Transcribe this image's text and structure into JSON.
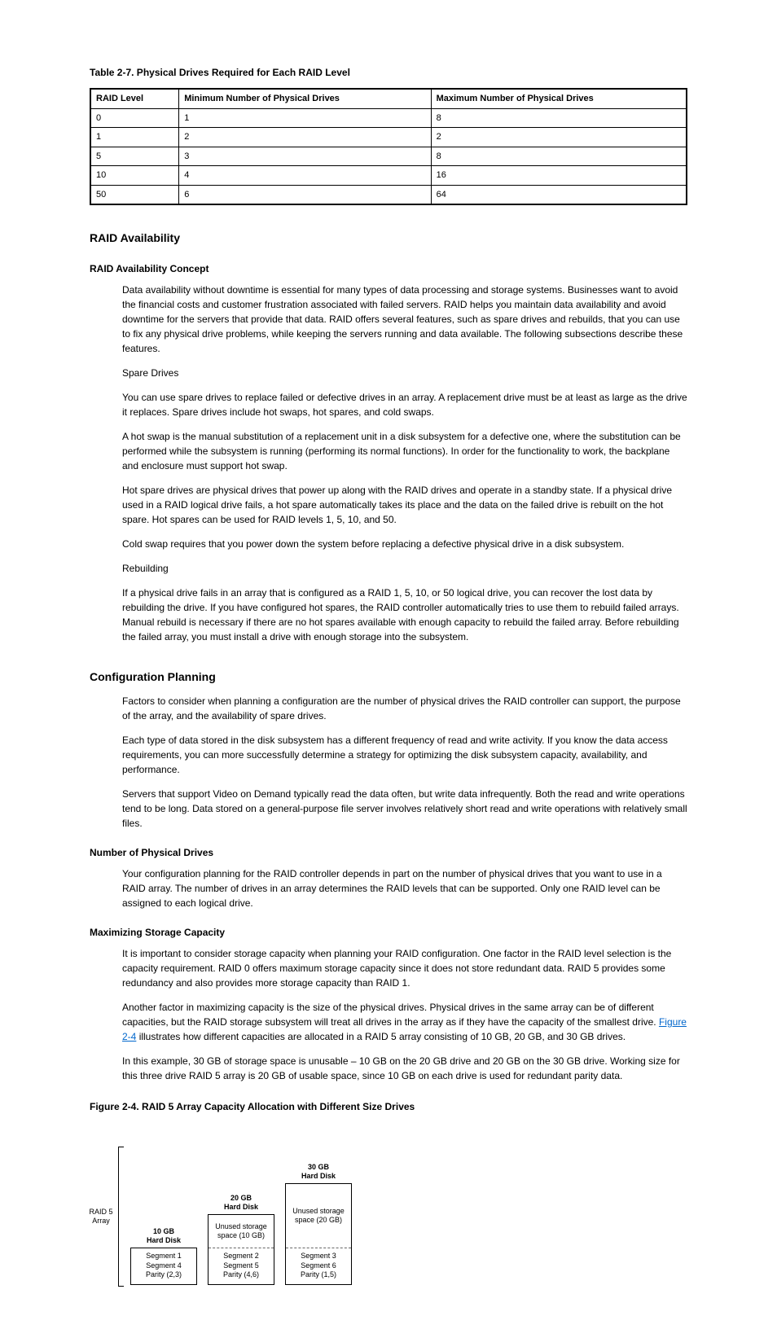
{
  "table7": {
    "title_prefix": "Table 2-",
    "title": "7. Physical Drives Required for Each RAID Level",
    "headers": [
      "RAID Level",
      "Minimum Number of Physical Drives",
      "Maximum Number of Physical Drives"
    ],
    "rows": [
      [
        "0",
        "1",
        "8"
      ],
      [
        "1",
        "2",
        "2"
      ],
      [
        "5",
        "3",
        "8"
      ],
      [
        "10",
        "4",
        "16"
      ],
      [
        "50",
        "6",
        "64"
      ]
    ]
  },
  "raid_avail": {
    "heading": "RAID Availability",
    "subheading": "RAID Availability Concept",
    "paragraphs": [
      "Data availability without downtime is essential for many types of data processing and storage systems. Businesses want to avoid the financial costs and customer frustration associated with failed servers. RAID helps you maintain data availability and avoid downtime for the servers that provide that data. RAID offers several features, such as spare drives and rebuilds, that you can use to fix any physical drive problems, while keeping the servers running and data available. The following subsections describe these features.",
      "Spare Drives",
      "You can use spare drives to replace failed or defective drives in an array. A replacement drive must be at least as large as the drive it replaces. Spare drives include hot swaps, hot spares, and cold swaps.",
      "A hot swap is the manual substitution of a replacement unit in a disk subsystem for a defective one, where the substitution can be performed while the subsystem is running (performing its normal functions). In order for the functionality to work, the backplane and enclosure must support hot swap.",
      "Hot spare drives are physical drives that power up along with the RAID drives and operate in a standby state. If a physical drive used in a RAID logical drive fails, a hot spare automatically takes its place and the data on the failed drive is rebuilt on the hot spare. Hot spares can be used for RAID levels 1, 5, 10, and 50.",
      "Cold swap requires that you power down the system before replacing a defective physical drive in a disk subsystem.",
      "Rebuilding",
      "If a physical drive fails in an array that is configured as a RAID 1, 5, 10, or 50 logical drive, you can recover the lost data by rebuilding the drive. If you have configured hot spares, the RAID controller automatically tries to use them to rebuild failed arrays. Manual rebuild is necessary if there are no hot spares available with enough capacity to rebuild the failed array. Before rebuilding the failed array, you must install a drive with enough storage into the subsystem."
    ]
  },
  "config": {
    "heading": "Configuration Planning",
    "paragraphs": [
      "Factors to consider when planning a configuration are the number of physical drives the RAID controller can support, the purpose of the array, and the availability of spare drives.",
      "Each type of data stored in the disk subsystem has a different frequency of read and write activity. If you know the data access requirements, you can more successfully determine a strategy for optimizing the disk subsystem capacity, availability, and performance.",
      "Servers that support Video on Demand typically read the data often, but write data infrequently. Both the read and write operations tend to be long. Data stored on a general-purpose file server involves relatively short read and write operations with relatively small files."
    ],
    "sub1_heading": "Number of Physical Drives",
    "sub1_paragraphs": [
      "Your configuration planning for the RAID controller depends in part on the number of physical drives that you want to use in a RAID array. The number of drives in an array determines the RAID levels that can be supported. Only one RAID level can be assigned to each logical drive."
    ],
    "sub2_heading": "Maximizing Storage Capacity",
    "sub2_paragraphs": [
      "It is important to consider storage capacity when planning your RAID configuration. One factor in the RAID level selection is the capacity requirement. RAID 0 offers maximum storage capacity since it does not store redundant data. RAID 5 provides some redundancy and also provides more storage capacity than RAID 1."
    ],
    "figlink_pre": "Another factor in maximizing capacity is the size of the physical drives. Physical drives in the same array can be of different capacities, but the RAID storage subsystem will treat all drives in the array as if they have the capacity of the smallest drive. ",
    "figlink_label": "Figure 2-4",
    "figlink_post": " illustrates how different capacities are allocated in a RAID 5 array consisting of 10 GB, 20 GB, and 30 GB drives.",
    "sub2_paragraphs2": [
      "In this example, 30 GB of storage space is unusable – 10 GB on the 20 GB drive and 20 GB on the 30 GB drive. Working size for this three drive RAID 5 array is 20 GB of usable space, since 10 GB on each drive is used for redundant parity data."
    ]
  },
  "figure": {
    "caption": "Figure 2-4.  RAID 5 Array Capacity Allocation with Different Size Drives",
    "array_label_l1": "RAID 5",
    "array_label_l2": "Array",
    "cols": [
      {
        "cap_l1": "10 GB",
        "cap_l2": "Hard Disk",
        "unused": "",
        "seg": [
          "Segment 1",
          "Segment 4",
          "Parity (2,3)"
        ]
      },
      {
        "cap_l1": "20 GB",
        "cap_l2": "Hard Disk",
        "unused": "Unused storage space (10 GB)",
        "seg": [
          "Segment 2",
          "Segment 5",
          "Parity (4,6)"
        ]
      },
      {
        "cap_l1": "30 GB",
        "cap_l2": "Hard Disk",
        "unused": "Unused storage space (20 GB)",
        "seg": [
          "Segment 3",
          "Segment 6",
          "Parity (1,5)"
        ]
      }
    ]
  }
}
